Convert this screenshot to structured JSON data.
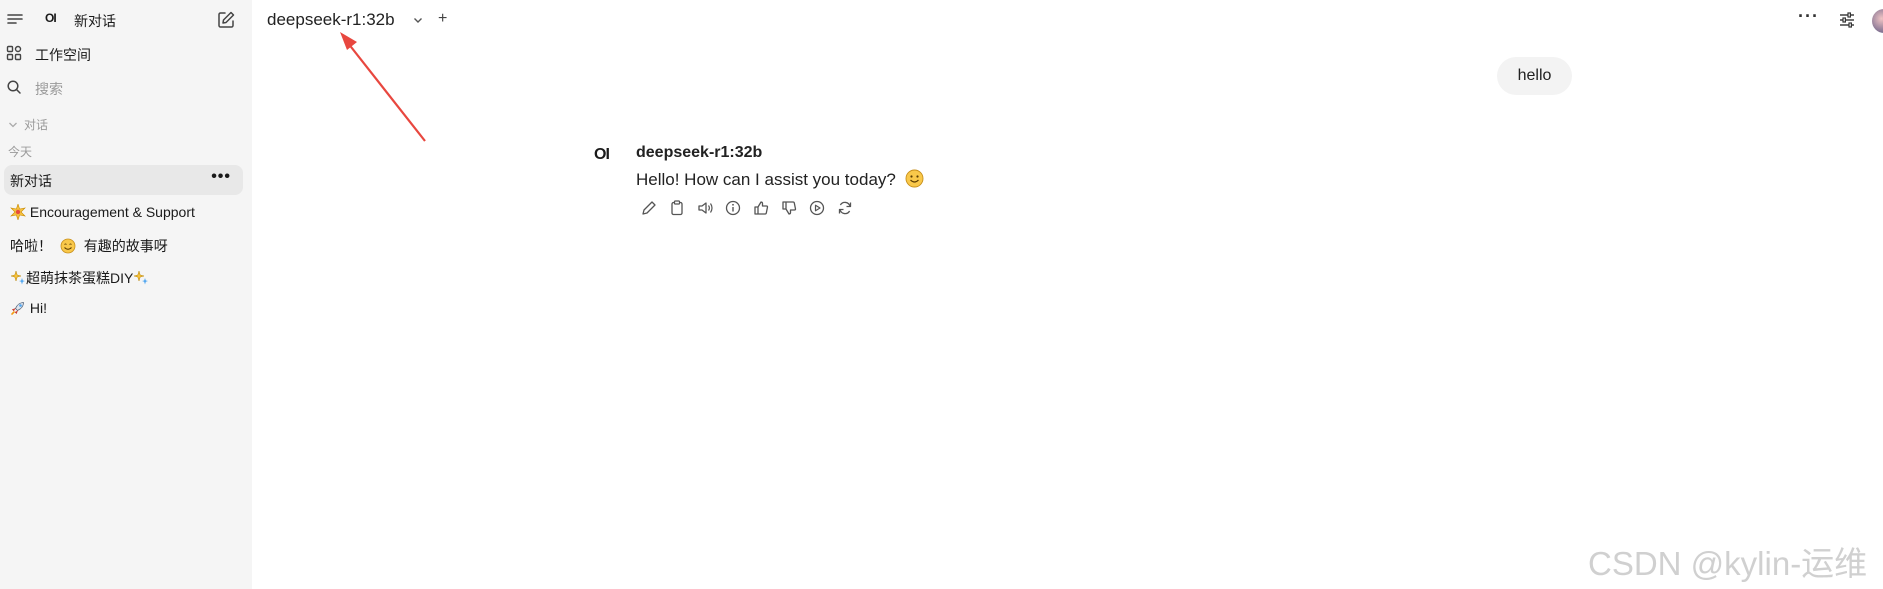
{
  "sidebar": {
    "logo": "OI",
    "new_chat_label": "新对话",
    "workspace_label": "工作空间",
    "search_label": "搜索",
    "section_title": "对话",
    "date_group": "今天",
    "chats": [
      {
        "title": "新对话",
        "active": true
      },
      {
        "title": "Encouragement & Support",
        "emoji": "sparkle-burst"
      },
      {
        "title_prefix": "哈啦！",
        "title": "有趣的故事呀",
        "emoji": "smiling-face"
      },
      {
        "title": "超萌抹茶蛋糕DIY",
        "emoji": "sparkles-stars"
      },
      {
        "title": "Hi!",
        "emoji": "rocket"
      }
    ],
    "more_label": "•••"
  },
  "header": {
    "model": "deepseek-r1:32b",
    "add_label": "+",
    "more_label": "···"
  },
  "chat": {
    "user_message": "hello",
    "assistant_avatar": "OI",
    "assistant_name": "deepseek-r1:32b",
    "assistant_message": "Hello! How can I assist you today?",
    "action_icons": [
      "edit-icon",
      "copy-icon",
      "speaker-icon",
      "info-icon",
      "thumbs-up-icon",
      "thumbs-down-icon",
      "play-icon",
      "regenerate-icon"
    ]
  },
  "watermark": "CSDN @kylin-运维",
  "colors": {
    "sidebar_bg": "#f5f5f5",
    "active_item_bg": "#e8e8e8",
    "user_bubble_bg": "#f3f3f3",
    "arrow_red": "#e8473f"
  }
}
